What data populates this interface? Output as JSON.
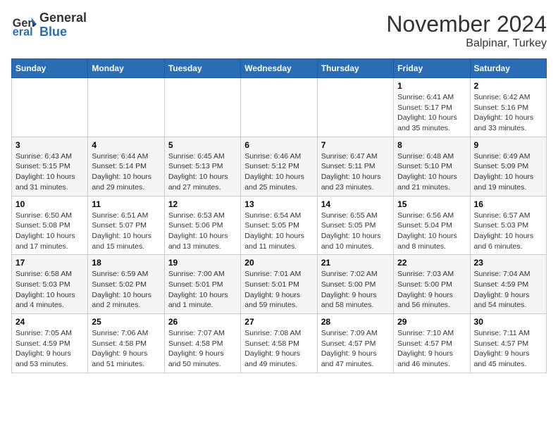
{
  "header": {
    "logo_general": "General",
    "logo_blue": "Blue",
    "title": "November 2024",
    "subtitle": "Balpinar, Turkey"
  },
  "weekdays": [
    "Sunday",
    "Monday",
    "Tuesday",
    "Wednesday",
    "Thursday",
    "Friday",
    "Saturday"
  ],
  "weeks": [
    [
      {
        "day": "",
        "info": ""
      },
      {
        "day": "",
        "info": ""
      },
      {
        "day": "",
        "info": ""
      },
      {
        "day": "",
        "info": ""
      },
      {
        "day": "",
        "info": ""
      },
      {
        "day": "1",
        "info": "Sunrise: 6:41 AM\nSunset: 5:17 PM\nDaylight: 10 hours\nand 35 minutes."
      },
      {
        "day": "2",
        "info": "Sunrise: 6:42 AM\nSunset: 5:16 PM\nDaylight: 10 hours\nand 33 minutes."
      }
    ],
    [
      {
        "day": "3",
        "info": "Sunrise: 6:43 AM\nSunset: 5:15 PM\nDaylight: 10 hours\nand 31 minutes."
      },
      {
        "day": "4",
        "info": "Sunrise: 6:44 AM\nSunset: 5:14 PM\nDaylight: 10 hours\nand 29 minutes."
      },
      {
        "day": "5",
        "info": "Sunrise: 6:45 AM\nSunset: 5:13 PM\nDaylight: 10 hours\nand 27 minutes."
      },
      {
        "day": "6",
        "info": "Sunrise: 6:46 AM\nSunset: 5:12 PM\nDaylight: 10 hours\nand 25 minutes."
      },
      {
        "day": "7",
        "info": "Sunrise: 6:47 AM\nSunset: 5:11 PM\nDaylight: 10 hours\nand 23 minutes."
      },
      {
        "day": "8",
        "info": "Sunrise: 6:48 AM\nSunset: 5:10 PM\nDaylight: 10 hours\nand 21 minutes."
      },
      {
        "day": "9",
        "info": "Sunrise: 6:49 AM\nSunset: 5:09 PM\nDaylight: 10 hours\nand 19 minutes."
      }
    ],
    [
      {
        "day": "10",
        "info": "Sunrise: 6:50 AM\nSunset: 5:08 PM\nDaylight: 10 hours\nand 17 minutes."
      },
      {
        "day": "11",
        "info": "Sunrise: 6:51 AM\nSunset: 5:07 PM\nDaylight: 10 hours\nand 15 minutes."
      },
      {
        "day": "12",
        "info": "Sunrise: 6:53 AM\nSunset: 5:06 PM\nDaylight: 10 hours\nand 13 minutes."
      },
      {
        "day": "13",
        "info": "Sunrise: 6:54 AM\nSunset: 5:05 PM\nDaylight: 10 hours\nand 11 minutes."
      },
      {
        "day": "14",
        "info": "Sunrise: 6:55 AM\nSunset: 5:05 PM\nDaylight: 10 hours\nand 10 minutes."
      },
      {
        "day": "15",
        "info": "Sunrise: 6:56 AM\nSunset: 5:04 PM\nDaylight: 10 hours\nand 8 minutes."
      },
      {
        "day": "16",
        "info": "Sunrise: 6:57 AM\nSunset: 5:03 PM\nDaylight: 10 hours\nand 6 minutes."
      }
    ],
    [
      {
        "day": "17",
        "info": "Sunrise: 6:58 AM\nSunset: 5:03 PM\nDaylight: 10 hours\nand 4 minutes."
      },
      {
        "day": "18",
        "info": "Sunrise: 6:59 AM\nSunset: 5:02 PM\nDaylight: 10 hours\nand 2 minutes."
      },
      {
        "day": "19",
        "info": "Sunrise: 7:00 AM\nSunset: 5:01 PM\nDaylight: 10 hours\nand 1 minute."
      },
      {
        "day": "20",
        "info": "Sunrise: 7:01 AM\nSunset: 5:01 PM\nDaylight: 9 hours\nand 59 minutes."
      },
      {
        "day": "21",
        "info": "Sunrise: 7:02 AM\nSunset: 5:00 PM\nDaylight: 9 hours\nand 58 minutes."
      },
      {
        "day": "22",
        "info": "Sunrise: 7:03 AM\nSunset: 5:00 PM\nDaylight: 9 hours\nand 56 minutes."
      },
      {
        "day": "23",
        "info": "Sunrise: 7:04 AM\nSunset: 4:59 PM\nDaylight: 9 hours\nand 54 minutes."
      }
    ],
    [
      {
        "day": "24",
        "info": "Sunrise: 7:05 AM\nSunset: 4:59 PM\nDaylight: 9 hours\nand 53 minutes."
      },
      {
        "day": "25",
        "info": "Sunrise: 7:06 AM\nSunset: 4:58 PM\nDaylight: 9 hours\nand 51 minutes."
      },
      {
        "day": "26",
        "info": "Sunrise: 7:07 AM\nSunset: 4:58 PM\nDaylight: 9 hours\nand 50 minutes."
      },
      {
        "day": "27",
        "info": "Sunrise: 7:08 AM\nSunset: 4:58 PM\nDaylight: 9 hours\nand 49 minutes."
      },
      {
        "day": "28",
        "info": "Sunrise: 7:09 AM\nSunset: 4:57 PM\nDaylight: 9 hours\nand 47 minutes."
      },
      {
        "day": "29",
        "info": "Sunrise: 7:10 AM\nSunset: 4:57 PM\nDaylight: 9 hours\nand 46 minutes."
      },
      {
        "day": "30",
        "info": "Sunrise: 7:11 AM\nSunset: 4:57 PM\nDaylight: 9 hours\nand 45 minutes."
      }
    ]
  ]
}
